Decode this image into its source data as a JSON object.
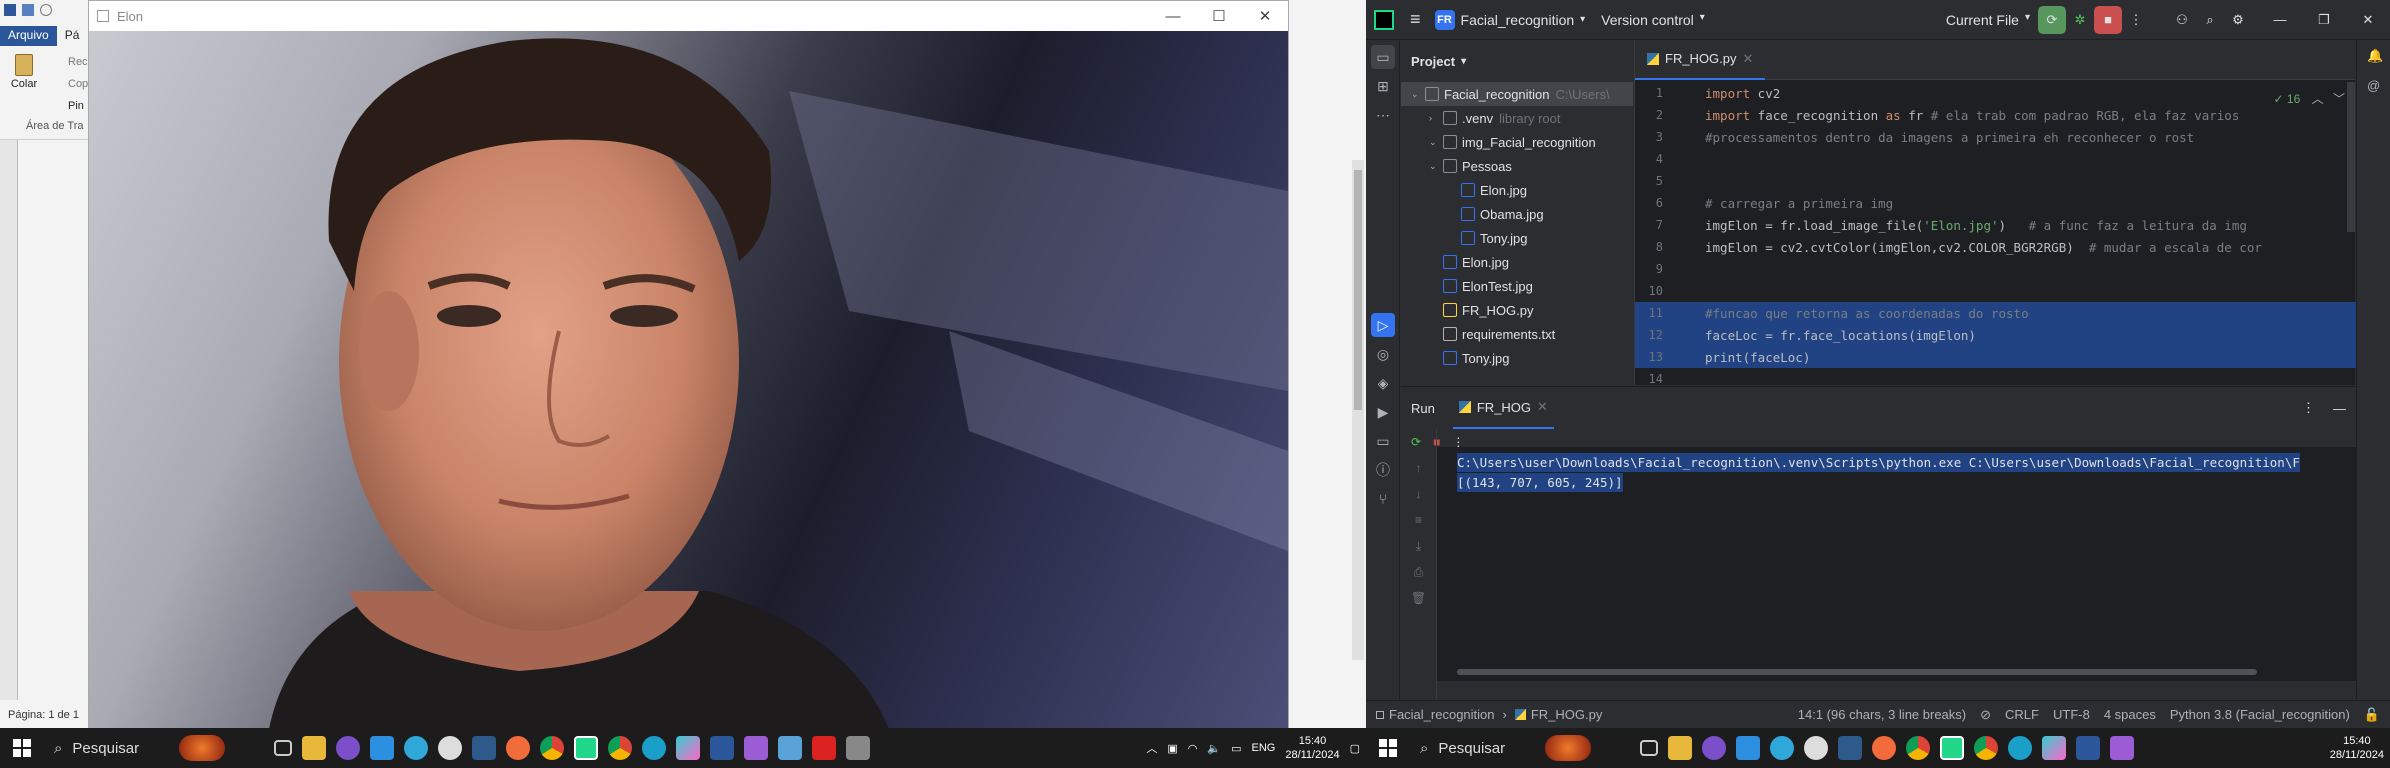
{
  "left": {
    "word": {
      "tabs": [
        "Arquivo",
        "Pá"
      ],
      "colar": "Colar",
      "rec": "Rec",
      "cop": "Cop",
      "pin": "Pin",
      "area": "Área de Tra",
      "page_status": "Página: 1 de 1"
    },
    "image_window": {
      "title": "Elon",
      "controls": [
        "—",
        "☐",
        "✕"
      ]
    },
    "taskbar": {
      "search": "Pesquisar",
      "lang": "ENG",
      "time": "15:40",
      "date": "28/11/2024"
    }
  },
  "right": {
    "toolbar": {
      "project_badge": "FR",
      "project_name": "Facial_recognition",
      "vcs": "Version control",
      "run_config": "Current File"
    },
    "project_panel": {
      "header": "Project",
      "rows": [
        {
          "indent": 0,
          "label": "Facial_recognition",
          "suffix": "C:\\Users\\",
          "type": "folder",
          "selected": true
        },
        {
          "indent": 1,
          "label": ".venv",
          "suffix": "library root",
          "type": "folder"
        },
        {
          "indent": 1,
          "label": "img_Facial_recognition",
          "suffix": "",
          "type": "folder"
        },
        {
          "indent": 1,
          "label": "Pessoas",
          "suffix": "",
          "type": "folder"
        },
        {
          "indent": 2,
          "label": "Elon.jpg",
          "suffix": "",
          "type": "img"
        },
        {
          "indent": 2,
          "label": "Obama.jpg",
          "suffix": "",
          "type": "img"
        },
        {
          "indent": 2,
          "label": "Tony.jpg",
          "suffix": "",
          "type": "img"
        },
        {
          "indent": 1,
          "label": "Elon.jpg",
          "suffix": "",
          "type": "img"
        },
        {
          "indent": 1,
          "label": "ElonTest.jpg",
          "suffix": "",
          "type": "img"
        },
        {
          "indent": 1,
          "label": "FR_HOG.py",
          "suffix": "",
          "type": "py"
        },
        {
          "indent": 1,
          "label": "requirements.txt",
          "suffix": "",
          "type": "txt"
        },
        {
          "indent": 1,
          "label": "Tony.jpg",
          "suffix": "",
          "type": "img"
        }
      ]
    },
    "editor": {
      "tab": "FR_HOG.py",
      "inspections": "✓ 16",
      "lines": [
        {
          "n": "1",
          "html": "<span class='kw'>import</span> cv2"
        },
        {
          "n": "2",
          "html": "<span class='kw'>import</span> face_recognition <span class='kw'>as</span> fr <span class='cm'># ela trab com padrao RGB, ela faz varios</span>"
        },
        {
          "n": "3",
          "html": "<span class='cm'>#processamentos dentro da imagens a primeira eh reconhecer o rost</span>"
        },
        {
          "n": "4",
          "html": ""
        },
        {
          "n": "5",
          "html": ""
        },
        {
          "n": "6",
          "html": "<span class='cm'># carregar a primeira img</span>"
        },
        {
          "n": "7",
          "html": "imgElon = fr.load_image_file(<span class='st'>'Elon.jpg'</span>)   <span class='cm'># a func faz a leitura da img</span>"
        },
        {
          "n": "8",
          "html": "imgElon = cv2.cvtColor(imgElon,cv2.COLOR_BGR2RGB)  <span class='cm'># mudar a escala de cor</span>"
        },
        {
          "n": "9",
          "html": ""
        },
        {
          "n": "10",
          "html": ""
        },
        {
          "n": "11",
          "html": "<span class='cm'>#funcao que retorna as coordenadas do rosto</span>",
          "hl": true
        },
        {
          "n": "12",
          "html": "faceLoc = fr.face_locations(imgElon)",
          "hl": true
        },
        {
          "n": "13",
          "html": "print(faceLoc)",
          "hl": true
        },
        {
          "n": "14",
          "html": ""
        }
      ]
    },
    "run": {
      "label": "Run",
      "tab": "FR_HOG",
      "output": [
        "C:\\Users\\user\\Downloads\\Facial_recognition\\.venv\\Scripts\\python.exe C:\\Users\\user\\Downloads\\Facial_recognition\\F",
        "[(143, 707, 605, 245)]"
      ]
    },
    "status": {
      "breadcrumb_project": "Facial_recognition",
      "breadcrumb_file": "FR_HOG.py",
      "position": "14:1 (96 chars, 3 line breaks)",
      "line_sep": "CRLF",
      "encoding": "UTF-8",
      "indent": "4 spaces",
      "interpreter": "Python 3.8 (Facial_recognition)"
    },
    "taskbar": {
      "search": "Pesquisar",
      "time": "15:40",
      "date": "28/11/2024"
    }
  }
}
